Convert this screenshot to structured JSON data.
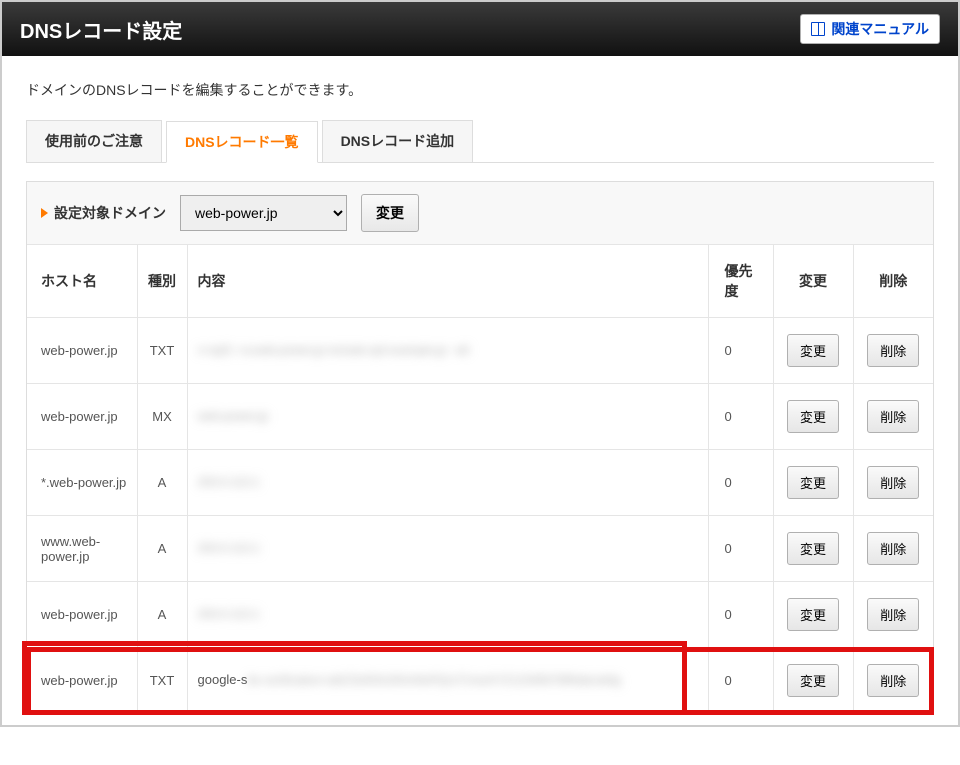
{
  "header": {
    "title": "DNSレコード設定",
    "manual_button": "関連マニュアル"
  },
  "description": "ドメインのDNSレコードを編集することができます。",
  "tabs": [
    {
      "label": "使用前のご注意",
      "active": false
    },
    {
      "label": "DNSレコード一覧",
      "active": true
    },
    {
      "label": "DNSレコード追加",
      "active": false
    }
  ],
  "domain_bar": {
    "label": "設定対象ドメイン",
    "selected": "web-power.jp",
    "change_button": "変更"
  },
  "table": {
    "headers": {
      "host": "ホスト名",
      "type": "種別",
      "content": "内容",
      "priority": "優先度",
      "edit": "変更",
      "delete": "削除"
    },
    "rows": [
      {
        "host": "web-power.jp",
        "type": "TXT",
        "content_visible": "",
        "content_blur": "v=spf1 +a:web-power.jp include:spf.example.jp ~all",
        "priority": "0",
        "edit": "変更",
        "delete": "削除"
      },
      {
        "host": "web-power.jp",
        "type": "MX",
        "content_visible": "",
        "content_blur": "web-power.jp",
        "priority": "0",
        "edit": "変更",
        "delete": "削除"
      },
      {
        "host": "*.web-power.jp",
        "type": "A",
        "content_visible": "",
        "content_blur": "203.0.113.1",
        "priority": "0",
        "edit": "変更",
        "delete": "削除"
      },
      {
        "host": "www.web-power.jp",
        "type": "A",
        "content_visible": "",
        "content_blur": "203.0.113.1",
        "priority": "0",
        "edit": "変更",
        "delete": "削除"
      },
      {
        "host": "web-power.jp",
        "type": "A",
        "content_visible": "",
        "content_blur": "203.0.113.1",
        "priority": "0",
        "edit": "変更",
        "delete": "削除"
      },
      {
        "host": "web-power.jp",
        "type": "TXT",
        "content_visible": "google-s",
        "content_blur": "ite-verification=abCDefGhiJKlmNoPQrsTUvwXYZ1234567890abcdefg",
        "priority": "0",
        "edit": "変更",
        "delete": "削除"
      }
    ]
  }
}
